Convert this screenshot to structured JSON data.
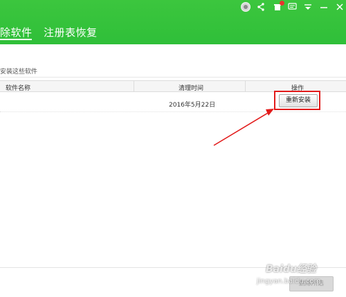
{
  "header": {
    "tabs": [
      {
        "label": "除软件",
        "active": true
      },
      {
        "label": "注册表恢复",
        "active": false
      }
    ],
    "accent_color": "#35c23b",
    "toolbar_icons": [
      "avatar-icon",
      "share-icon",
      "notification-icon",
      "chat-icon",
      "menu-icon",
      "minimize-icon",
      "close-icon"
    ],
    "notification_badge_color": "#e8332e"
  },
  "intro_text": "安装这些软件",
  "table": {
    "columns": [
      "软件名称",
      "清理时间",
      "操作"
    ],
    "rows": [
      {
        "name": "",
        "time": "2016年5月22日",
        "action": "重新安装"
      }
    ]
  },
  "annotation": {
    "color": "#e21a1a"
  },
  "footer": {
    "button_label": "删除所选"
  },
  "watermark": {
    "logo": "Baidu经验",
    "url": "jingyan.baidu.com"
  }
}
